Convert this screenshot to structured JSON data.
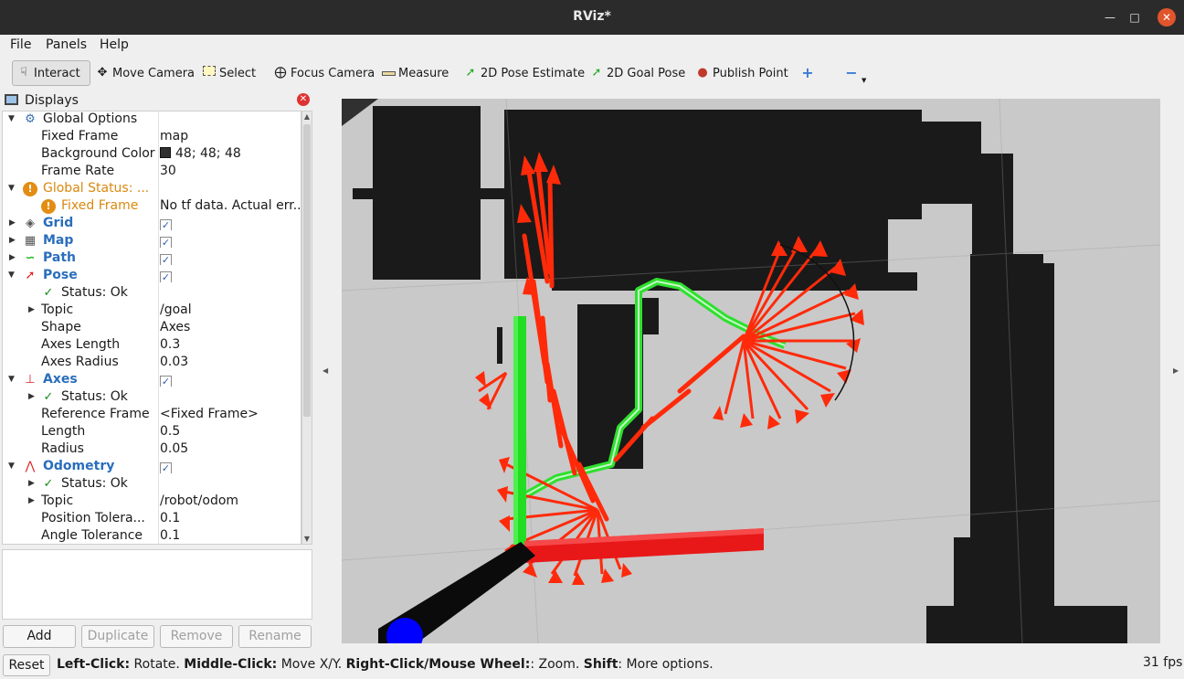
{
  "window": {
    "title": "RViz*"
  },
  "menu": {
    "file": "File",
    "panels": "Panels",
    "help": "Help"
  },
  "toolbar": {
    "interact": "Interact",
    "move_camera": "Move Camera",
    "select": "Select",
    "focus_camera": "Focus Camera",
    "measure": "Measure",
    "pose_estimate": "2D Pose Estimate",
    "goal_pose": "2D Goal Pose",
    "publish_point": "Publish Point"
  },
  "displays": {
    "title": "Displays",
    "rows": [
      {
        "name": "Global Options",
        "value": ""
      },
      {
        "name": "Fixed Frame",
        "value": "map"
      },
      {
        "name": "Background Color",
        "value": "48; 48; 48"
      },
      {
        "name": "Frame Rate",
        "value": "30"
      },
      {
        "name": "Global Status: ...",
        "value": ""
      },
      {
        "name": "Fixed Frame",
        "value": "No tf data.  Actual err..."
      },
      {
        "name": "Grid",
        "value": ""
      },
      {
        "name": "Map",
        "value": ""
      },
      {
        "name": "Path",
        "value": ""
      },
      {
        "name": "Pose",
        "value": ""
      },
      {
        "name": "Status: Ok",
        "value": ""
      },
      {
        "name": "Topic",
        "value": "/goal"
      },
      {
        "name": "Shape",
        "value": "Axes"
      },
      {
        "name": "Axes Length",
        "value": "0.3"
      },
      {
        "name": "Axes Radius",
        "value": "0.03"
      },
      {
        "name": "Axes",
        "value": ""
      },
      {
        "name": "Status: Ok",
        "value": ""
      },
      {
        "name": "Reference Frame",
        "value": "<Fixed Frame>"
      },
      {
        "name": "Length",
        "value": "0.5"
      },
      {
        "name": "Radius",
        "value": "0.05"
      },
      {
        "name": "Odometry",
        "value": ""
      },
      {
        "name": "Status: Ok",
        "value": ""
      },
      {
        "name": "Topic",
        "value": "/robot/odom"
      },
      {
        "name": "Position Tolera...",
        "value": "0.1"
      },
      {
        "name": "Angle Tolerance",
        "value": "0.1"
      }
    ],
    "checkmark": "✓",
    "buttons": {
      "add": "Add",
      "duplicate": "Duplicate",
      "remove": "Remove",
      "rename": "Rename"
    }
  },
  "status": {
    "reset": "Reset",
    "left_click_key": "Left-Click:",
    "left_click_desc": " Rotate. ",
    "middle_click_key": "Middle-Click:",
    "middle_click_desc": " Move X/Y. ",
    "right_click_key": "Right-Click/Mouse Wheel:",
    "right_click_desc": ": Zoom. ",
    "shift_key": "Shift",
    "shift_desc": ": More options.",
    "fps": "31 fps"
  },
  "colors": {
    "background": "#303030",
    "pose_arrow": "#ff2a0a",
    "path": "#00ff00",
    "axis_x": "#ff1a1a",
    "axis_y": "#22dd22",
    "axis_z": "#0000ff",
    "link_blue": "#2a6ebc",
    "warning_orange": "#d8890f"
  }
}
